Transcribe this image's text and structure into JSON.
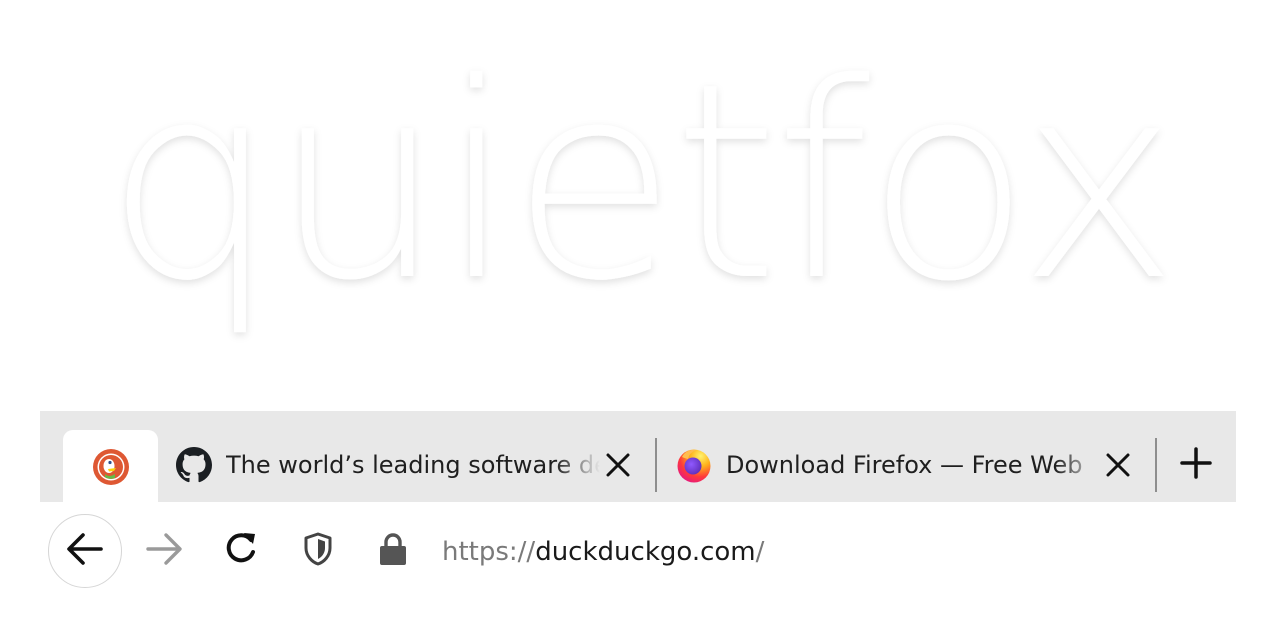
{
  "branding": {
    "logo_text": "quietfox"
  },
  "tabs": [
    {
      "title": "",
      "favicon": "duckduckgo-icon",
      "active": true
    },
    {
      "title": "The world’s leading software de",
      "favicon": "github-icon",
      "close_icon": "close-icon"
    },
    {
      "title": "Download Firefox — Free Web",
      "favicon": "firefox-icon",
      "close_icon": "close-icon"
    }
  ],
  "toolbar": {
    "new_tab_icon": "plus-icon",
    "back_icon": "arrow-left-icon",
    "forward_icon": "arrow-right-icon",
    "reload_icon": "reload-icon",
    "tracking_protection_icon": "shield-icon",
    "secure_icon": "lock-icon"
  },
  "urlbar": {
    "scheme": "https://",
    "host": "duckduckgo.com",
    "path": "/"
  },
  "colors": {
    "tabstrip_bg": "#e8e8e8",
    "active_tab_bg": "#ffffff",
    "text": "#1f1f1f",
    "url_dim": "#7a7a7a",
    "forward_disabled": "#9a9a9a",
    "duckduckgo_orange": "#de5833",
    "firefox_orange": "#ff7139",
    "firefox_purple": "#6e2aa8"
  }
}
